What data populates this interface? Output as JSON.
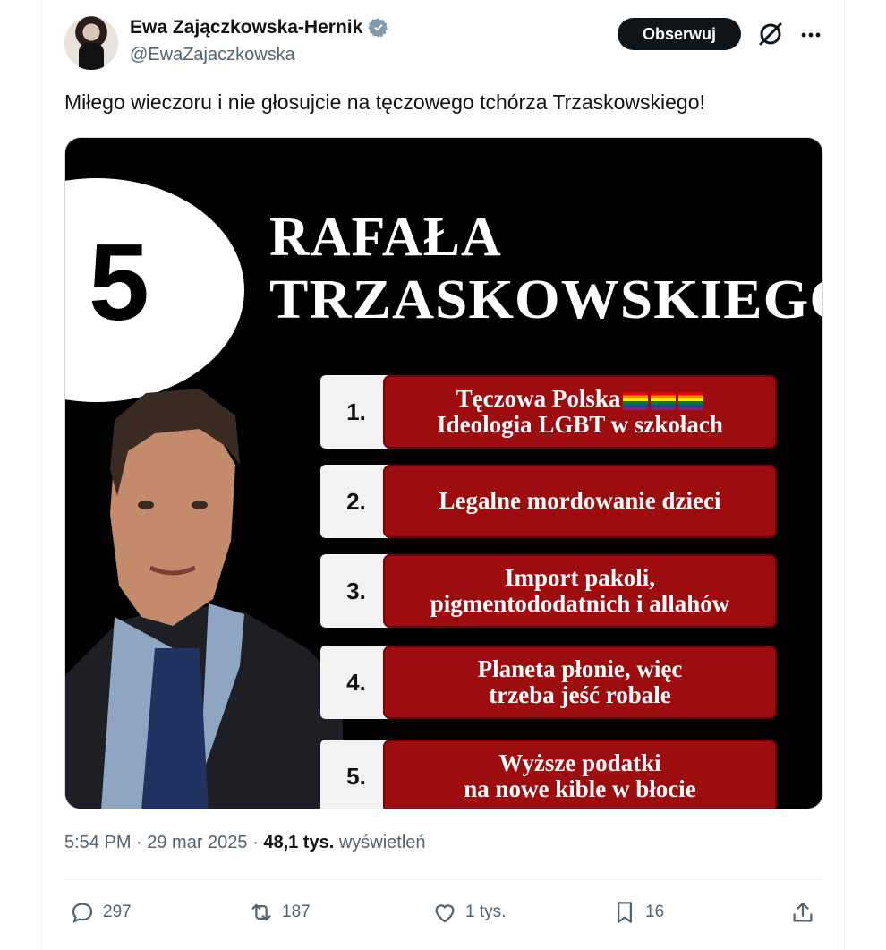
{
  "author": {
    "name": "Ewa Zajączkowska-Hernik",
    "handle": "@EwaZajaczkowska",
    "verified": true
  },
  "header_actions": {
    "follow_label": "Obserwuj"
  },
  "tweet": {
    "text": "Miłego wieczoru i nie głosujcie na tęczowego tchórza Trzaskowskiego!",
    "timestamp": "5:54 PM · 29 mar 2025 · ",
    "views_count": "48,1 tys.",
    "views_label": " wyświetleń"
  },
  "media": {
    "number": "5",
    "title_line1": "RAFAŁA",
    "title_line2": "TRZASKOWSKIEGO",
    "items": [
      {
        "num": "1.",
        "line1": "Tęczowa Polska",
        "line2": "Ideologia LGBT w szkołach",
        "flags": 3
      },
      {
        "num": "2.",
        "line1": "Legalne mordowanie dzieci",
        "line2": ""
      },
      {
        "num": "3.",
        "line1": "Import pakoli,",
        "line2": "pigmentododatnich i allahów"
      },
      {
        "num": "4.",
        "line1": "Planeta płonie, więc",
        "line2": "trzeba jeść robale"
      },
      {
        "num": "5.",
        "line1": "Wyższe podatki",
        "line2": "na nowe kible w błocie"
      }
    ]
  },
  "engagement": {
    "replies": "297",
    "reposts": "187",
    "likes": "1 tys.",
    "bookmarks": "16"
  },
  "colors": {
    "accent_verified": "#829aab",
    "list_item_red": "#9d0c0f",
    "follow_button_bg": "#0f1419",
    "secondary_text": "#536471"
  },
  "icons": [
    "verified-icon",
    "grok-icon",
    "more-icon",
    "reply-icon",
    "repost-icon",
    "like-icon",
    "bookmark-icon",
    "share-icon"
  ]
}
